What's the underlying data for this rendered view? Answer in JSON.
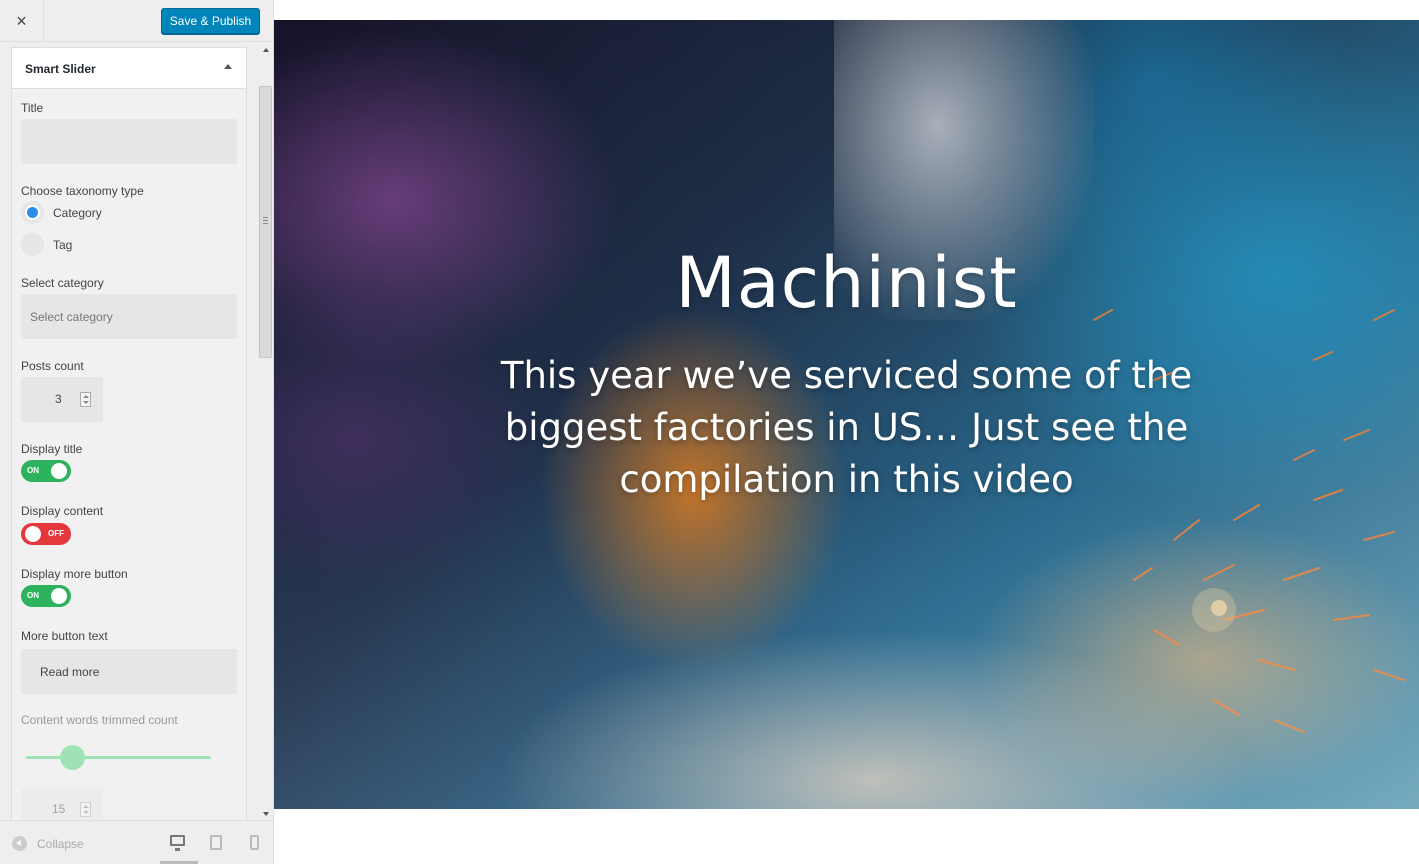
{
  "topbar": {
    "close_label": "×",
    "save_label": "Save & Publish"
  },
  "panel": {
    "title": "Smart Slider"
  },
  "fields": {
    "title": {
      "label": "Title",
      "value": ""
    },
    "taxonomy": {
      "label": "Choose taxonomy type",
      "options": [
        "Category",
        "Tag"
      ],
      "selected": "Category"
    },
    "category": {
      "label": "Select category",
      "placeholder": "Select category"
    },
    "posts_count": {
      "label": "Posts count",
      "value": "3"
    },
    "display_title": {
      "label": "Display title",
      "state": "ON"
    },
    "display_content": {
      "label": "Display content",
      "state": "OFF"
    },
    "display_more_button": {
      "label": "Display more button",
      "state": "ON"
    },
    "more_button_text": {
      "label": "More button text",
      "value": "Read more"
    },
    "trim_count": {
      "label": "Content words trimmed count",
      "value": "15",
      "slider_fraction": 0.25
    }
  },
  "footer": {
    "collapse_label": "Collapse",
    "devices": [
      "desktop",
      "tablet",
      "mobile"
    ],
    "active_device": "desktop"
  },
  "hero": {
    "title": "Machinist",
    "text": "This year we’ve serviced some of the biggest factories in US… Just see the compilation in this video"
  },
  "colors": {
    "primary": "#0085ba",
    "toggle_on": "#2db35e",
    "toggle_off": "#e4383c",
    "radio": "#2a8ee8"
  }
}
